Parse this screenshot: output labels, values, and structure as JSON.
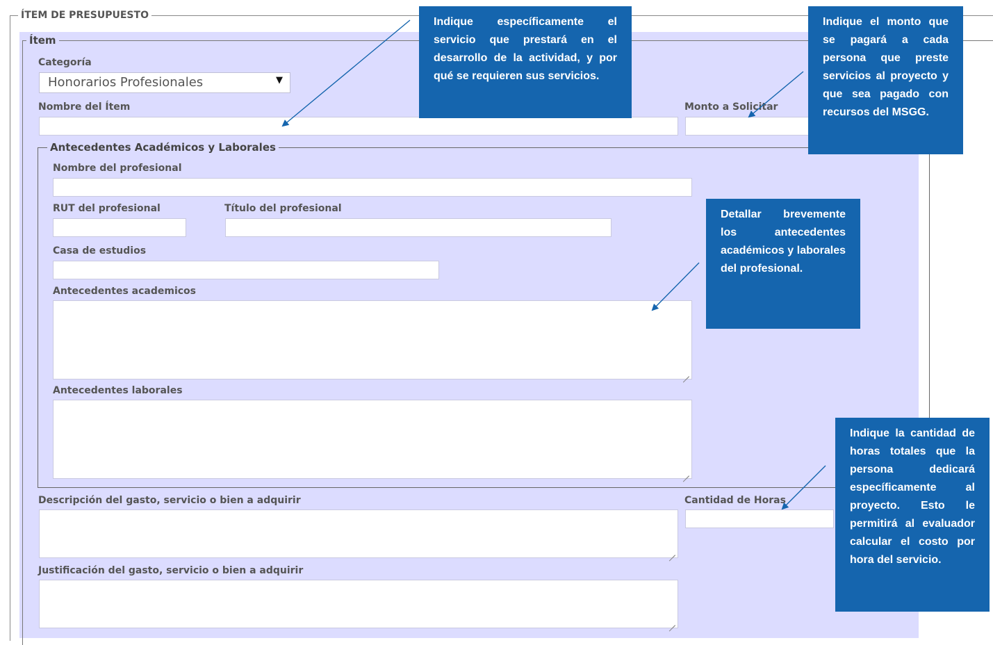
{
  "form": {
    "section_title": "ÍTEM DE PRESUPUESTO",
    "item_legend": "Ítem",
    "category_label": "Categoría",
    "category_selected": "Honorarios Profesionales",
    "item_name_label": "Nombre del Ítem",
    "amount_label": "Monto a Solicitar",
    "background_legend": "Antecedentes Académicos y Laborales",
    "prof_name_label": "Nombre del profesional",
    "rut_label": "RUT del profesional",
    "title_label": "Título del profesional",
    "school_label": "Casa de estudios",
    "academic_label": "Antecedentes academicos",
    "work_label": "Antecedentes laborales",
    "description_label": "Descripción del gasto, servicio o bien a adquirir",
    "hours_label": "Cantidad de Horas",
    "justification_label": "Justificación del gasto, servicio o bien a adquirir"
  },
  "callouts": {
    "service": "Indique específicamente el servicio que prestará en el desarrollo de la actividad, y por qué se requieren sus servicios.",
    "amount": "Indique el monto que se pagará a cada persona que preste servicios al proyecto y que sea pagado con recursos del MSGG.",
    "background": "Detallar brevemente los antecedentes académicos y laborales del profesional.",
    "hours": "Indique la cantidad de horas totales que la persona dedicará específicamente al proyecto. Esto le permitirá al evaluador calcular el costo por hora del servicio."
  },
  "colors": {
    "panel_bg": "#dcdcff",
    "callout_bg": "#1565ae",
    "arrow": "#1565ae"
  }
}
